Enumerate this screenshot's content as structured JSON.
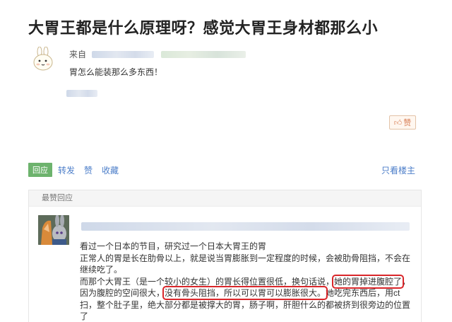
{
  "question": {
    "title": "大胃王都是什么原理呀？感觉大胃王身材都那么小",
    "from_label": "来自",
    "body": "胃怎么能装那么多东西！"
  },
  "like_button": {
    "label": "赞"
  },
  "actions": {
    "reply": "回应",
    "forward": "转发",
    "like": "赞",
    "collect": "收藏",
    "only_owner": "只看楼主"
  },
  "best_reply": {
    "header": "最赞回应",
    "lines": [
      "看过一个日本的节目，研究过一个日本大胃王的胃",
      "正常人的胃是长在肋骨以上，就是说当胃膨胀到一定程度的时候，会被肋骨阻挡，不会在继续吃了。"
    ],
    "para2_before": "而那个大胃王（是一个较小的女生）的胃长得位置很低，换句话说，",
    "para2_hl1": "她的胃掉进腹腔了",
    "para2_mid1": "，因为腹腔的空间很大，",
    "para2_hl2": "没有骨头阻挡，所以可以胃可以膨胀很大。",
    "para2_after": "她吃完东西后，用ct扫，整个肚子里，绝大部分都是被撑大的胃，肠子啊，肝胆什么的都被挤到很旁边的位置了"
  },
  "colors": {
    "accent_link": "#4c7ec9",
    "reply_green": "#6db36d",
    "highlight_red": "#d9262a"
  }
}
